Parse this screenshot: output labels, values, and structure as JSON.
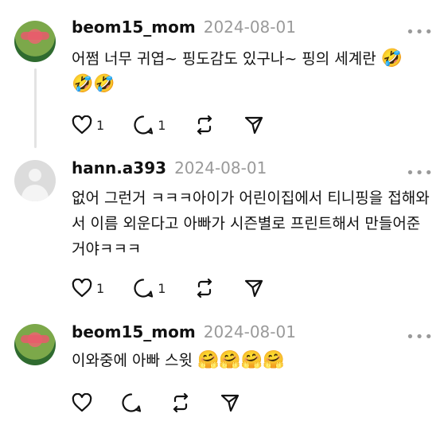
{
  "posts": [
    {
      "username": "beom15_mom",
      "date": "2024-08-01",
      "text": "어쩜 너무 귀엽~ 핑도감도 있구나~ 핑의 세계란",
      "text_emoji": "🤣",
      "text_line2": "🤣🤣",
      "likes": "1",
      "replies": "1"
    },
    {
      "username": "hann.a393",
      "date": "2024-08-01",
      "text": "없어 그런거 ㅋㅋㅋ아이가 어린이집에서 티니핑을 접해와서 이름 외운다고 아빠가 시즌별로 프린트해서 만들어준거야ㅋㅋㅋ",
      "likes": "1",
      "replies": "1"
    },
    {
      "username": "beom15_mom",
      "date": "2024-08-01",
      "text": "이와중에 아빠 스윗",
      "text_emoji": "🤗🤗🤗🤗"
    }
  ],
  "icons": [
    "heart-icon",
    "comment-icon",
    "repost-icon",
    "share-icon",
    "more-icon"
  ]
}
